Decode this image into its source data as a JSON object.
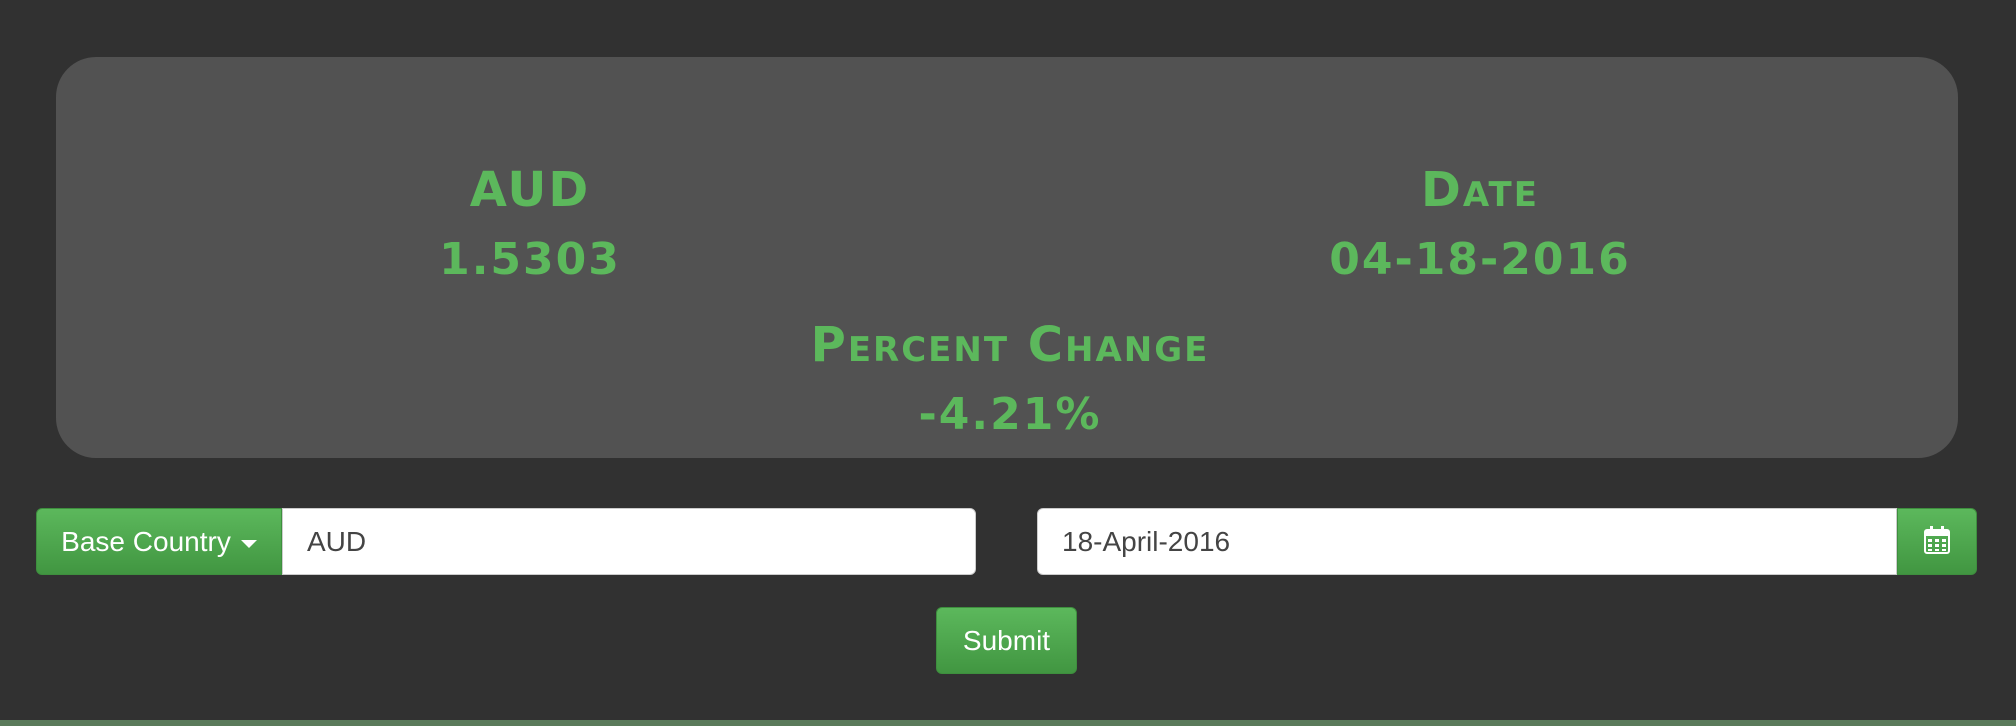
{
  "summary": {
    "currency_label": "AUD",
    "currency_rate": "1.5303",
    "date_label": "Date",
    "date_value": "04-18-2016",
    "change_label": "Percent Change",
    "change_value": "-4.21%"
  },
  "form": {
    "base_country_button": "Base Country",
    "currency_value": "AUD",
    "date_value": "18-April-2016",
    "calendar_icon": "calendar-icon",
    "submit_label": "Submit"
  },
  "colors": {
    "accent": "#5cb85c",
    "background": "#313131",
    "panel": "#525252"
  }
}
